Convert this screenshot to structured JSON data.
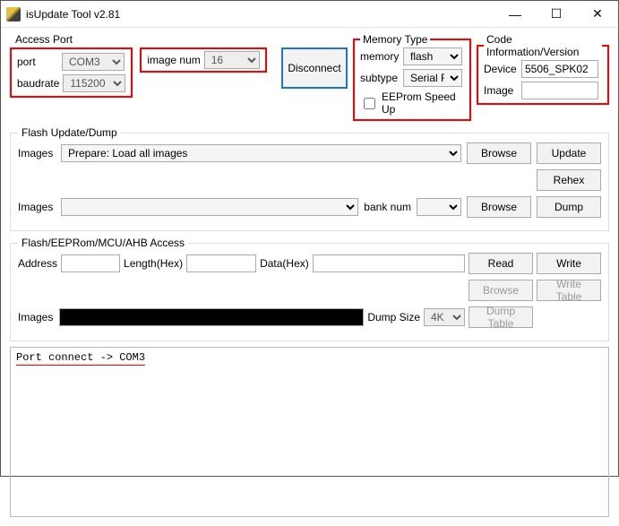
{
  "window": {
    "title": "isUpdate Tool v2.81"
  },
  "accessPort": {
    "legend": "Access Port",
    "portLabel": "port",
    "portValue": "COM3",
    "baudLabel": "baudrate",
    "baudValue": "115200",
    "imageNumLabel": "image num",
    "imageNumValue": "16",
    "disconnect": "Disconnect"
  },
  "memoryType": {
    "legend": "Memory Type",
    "memoryLabel": "memory",
    "memoryValue": "flash",
    "subtypeLabel": "subtype",
    "subtypeValue": "Serial Flash",
    "eepromSpeed": "EEProm Speed Up"
  },
  "codeInfo": {
    "legend": "Code Information/Version",
    "deviceLabel": "Device",
    "deviceValue": "5506_SPK02",
    "imageLabel": "Image",
    "imageValue": ""
  },
  "flashUpdate": {
    "legend": "Flash Update/Dump",
    "imagesLabel": "Images",
    "prepareValue": "Prepare: Load all images",
    "browse": "Browse",
    "update": "Update",
    "rehex": "Rehex",
    "bankNumLabel": "bank num",
    "dump": "Dump"
  },
  "flashAccess": {
    "legend": "Flash/EEPRom/MCU/AHB Access",
    "addressLabel": "Address",
    "lengthLabel": "Length(Hex)",
    "dataLabel": "Data(Hex)",
    "read": "Read",
    "write": "Write",
    "browse": "Browse",
    "writeTable": "Write Table",
    "imagesLabel": "Images",
    "dumpSizeLabel": "Dump Size",
    "dumpSizeValue": "4K",
    "dumpTable": "Dump Table"
  },
  "log": {
    "line1": "Port connect -> COM3"
  }
}
